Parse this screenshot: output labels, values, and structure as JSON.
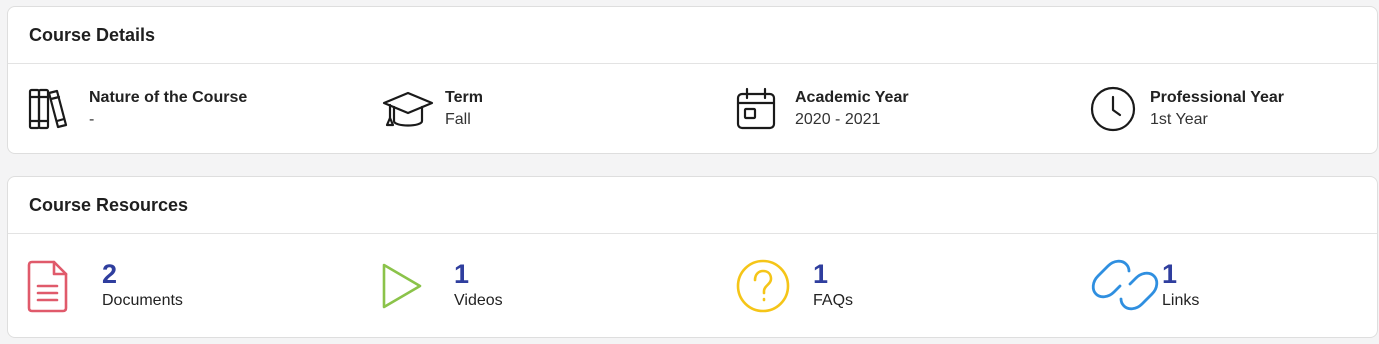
{
  "details": {
    "title": "Course Details",
    "items": [
      {
        "label": "Nature of the Course",
        "value": "-",
        "icon": "books-icon"
      },
      {
        "label": "Term",
        "value": "Fall",
        "icon": "graduation-cap-icon"
      },
      {
        "label": "Academic Year",
        "value": "2020 - 2021",
        "icon": "calendar-icon"
      },
      {
        "label": "Professional Year",
        "value": "1st Year",
        "icon": "clock-icon"
      }
    ]
  },
  "resources": {
    "title": "Course Resources",
    "items": [
      {
        "count": "2",
        "label": "Documents",
        "icon": "document-icon",
        "color": "#e05a6b"
      },
      {
        "count": "1",
        "label": "Videos",
        "icon": "play-icon",
        "color": "#8bc34a"
      },
      {
        "count": "1",
        "label": "FAQs",
        "icon": "question-icon",
        "color": "#f5c518"
      },
      {
        "count": "1",
        "label": "Links",
        "icon": "link-icon",
        "color": "#2f8fe0"
      }
    ],
    "count_color": "#2f3e9e"
  }
}
